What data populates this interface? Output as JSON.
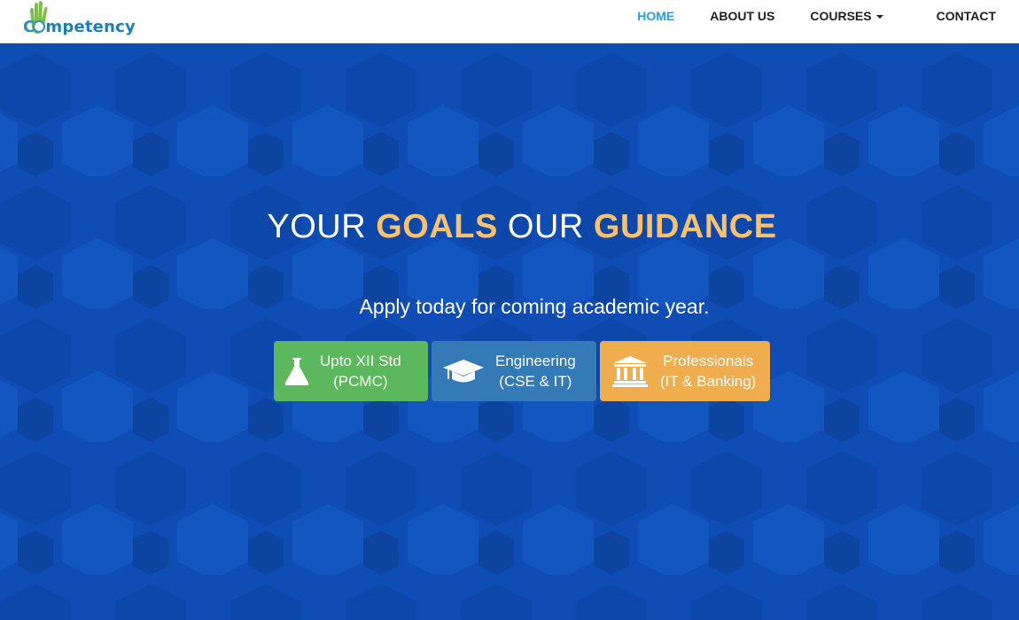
{
  "brand": {
    "logo_text_c": "C",
    "logo_text_rest": "mpetency"
  },
  "nav": {
    "home": "HOME",
    "about": "ABOUT US",
    "courses": "COURSES",
    "contact": "CONTACT"
  },
  "hero": {
    "headline": {
      "part1": "YOUR ",
      "part2": "GOALS",
      "part3": " OUR ",
      "part4": "GUIDANCE"
    },
    "subtitle": "Apply today for coming academic year.",
    "buttons": [
      {
        "line1": "Upto XII Std",
        "line2": "(PCMC)",
        "icon": "flask-icon",
        "color": "#5cb85c"
      },
      {
        "line1": "Engineering",
        "line2": "(CSE & IT)",
        "icon": "graduation-cap-icon",
        "color": "#337ab7"
      },
      {
        "line1": "Professionals",
        "line2": "(IT & Banking)",
        "icon": "bank-icon",
        "color": "#f0ad4e"
      }
    ]
  },
  "colors": {
    "hero_bg": "#0f4db5",
    "accent_gold": "#f8c16a",
    "nav_active": "#2e9be4"
  }
}
